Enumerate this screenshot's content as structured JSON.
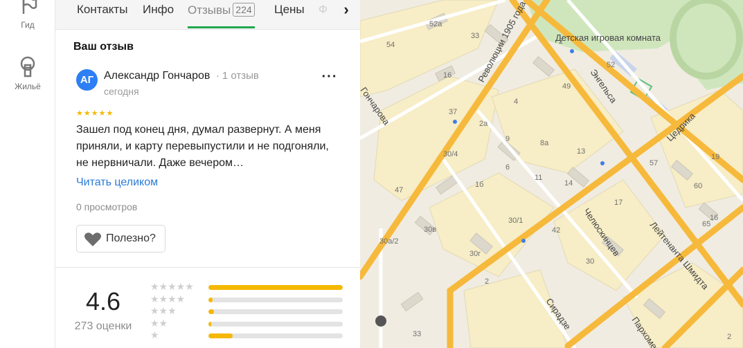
{
  "rail": {
    "guide_label": "Гид",
    "housing_label": "Жильё"
  },
  "tabs": [
    {
      "label": "Контакты"
    },
    {
      "label": "Инфо"
    },
    {
      "label": "Отзывы",
      "count": "224"
    },
    {
      "label": "Цены"
    },
    {
      "label": "Ф"
    }
  ],
  "review": {
    "section_title": "Ваш отзыв",
    "avatar_initials": "АГ",
    "author": "Александр Гончаров",
    "author_count": "1 отзыв",
    "date": "сегодня",
    "rating_stars": "★★★★★",
    "text": "Зашел под конец дня, думал развернут. А меня приняли, и карту перевыпустили и не подгоняли, не нервничали. Даже вечером…",
    "read_more": "Читать целиком",
    "views": "0 просмотров",
    "useful_label": "Полезно?"
  },
  "rating": {
    "value": "4.6",
    "count_label": "273 оценки",
    "distribution": [
      {
        "stars": "★★★★★",
        "fraction": 1.0
      },
      {
        "stars": "★★★★",
        "fraction": 0.03
      },
      {
        "stars": "★★★",
        "fraction": 0.04
      },
      {
        "stars": "★★",
        "fraction": 0.02
      },
      {
        "stars": "★",
        "fraction": 0.18
      }
    ]
  },
  "map": {
    "streets": {
      "revolution": "Революции 1905 года",
      "engelsa": "Энгельса",
      "tsedrika": "Цедрика",
      "leytenanta": "Лейтенанта Шмидта",
      "chelyuskintsev": "Челюскинцев",
      "goncharova": "Гончарова",
      "siradze": "Сирадзе",
      "parkhomenko": "Пархоменко"
    },
    "poi": "Детская игровая комната",
    "numbers": [
      "52а",
      "33",
      "54",
      "2",
      "16",
      "37",
      "49",
      "4",
      "52",
      "2а",
      "9",
      "8а",
      "13",
      "30/4",
      "6",
      "11",
      "14",
      "57",
      "19",
      "60",
      "16",
      "47",
      "1б",
      "17",
      "30/1",
      "42",
      "65",
      "30в",
      "30а/2",
      "30г",
      "30",
      "2",
      "33",
      "2"
    ]
  }
}
